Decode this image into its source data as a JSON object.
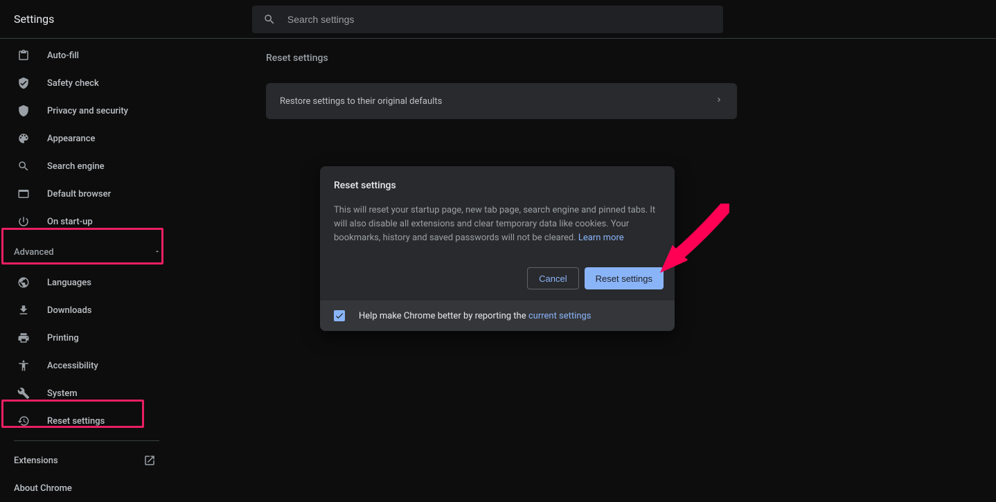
{
  "header": {
    "title": "Settings"
  },
  "search": {
    "placeholder": "Search settings"
  },
  "sidebar": {
    "items": [
      {
        "label": "Auto-fill"
      },
      {
        "label": "Safety check"
      },
      {
        "label": "Privacy and security"
      },
      {
        "label": "Appearance"
      },
      {
        "label": "Search engine"
      },
      {
        "label": "Default browser"
      },
      {
        "label": "On start-up"
      }
    ],
    "advanced_label": "Advanced",
    "advanced_items": [
      {
        "label": "Languages"
      },
      {
        "label": "Downloads"
      },
      {
        "label": "Printing"
      },
      {
        "label": "Accessibility"
      },
      {
        "label": "System"
      },
      {
        "label": "Reset settings"
      }
    ],
    "footer": {
      "extensions": "Extensions",
      "about": "About Chrome"
    }
  },
  "main": {
    "section_title": "Reset settings",
    "row_label": "Restore settings to their original defaults"
  },
  "dialog": {
    "title": "Reset settings",
    "body": "This will reset your startup page, new tab page, search engine and pinned tabs. It will also disable all extensions and clear temporary data like cookies. Your bookmarks, history and saved passwords will not be cleared. ",
    "learn_more": "Learn more",
    "cancel": "Cancel",
    "confirm": "Reset settings",
    "footer_text": "Help make Chrome better by reporting the ",
    "footer_link": "current settings"
  }
}
